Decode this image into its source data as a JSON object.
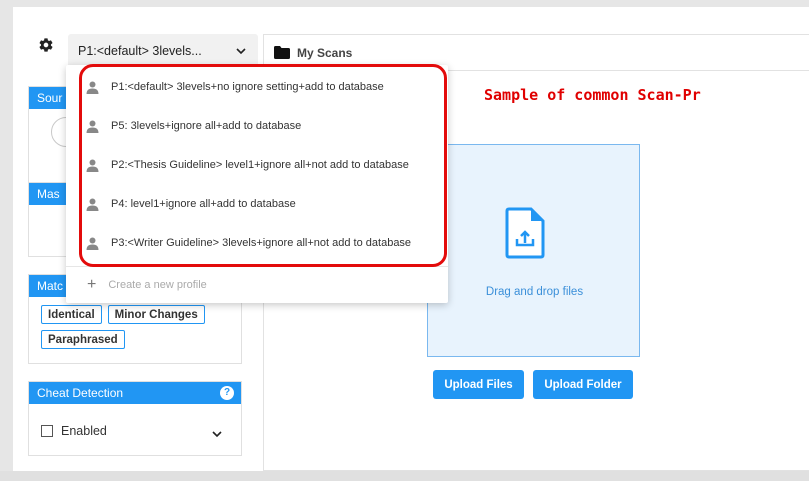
{
  "profile": {
    "selected": "P1:<default> 3levels..."
  },
  "scans": {
    "title": "My Scans"
  },
  "panels": {
    "source_label": "Sour",
    "mask_label": "Mas",
    "match_label": "Matc",
    "match_chips": [
      "Identical",
      "Minor Changes",
      "Paraphrased"
    ],
    "cheat_label": "Cheat Detection",
    "cheat_help": "?",
    "cheat_option": "Enabled"
  },
  "dropzone": {
    "text": "Drag and drop files"
  },
  "buttons": {
    "upload_files": "Upload Files",
    "upload_folder": "Upload Folder"
  },
  "annotation": "Sample of common Scan-Pr",
  "dropdown": {
    "items": [
      {
        "label": "P1:<default> 3levels+no ignore setting+add to database"
      },
      {
        "label": "P5: 3levels+ignore all+add to database"
      },
      {
        "label": "P2:<Thesis Guideline> level1+ignore all+not add to database"
      },
      {
        "label": "P4: level1+ignore all+add to database"
      },
      {
        "label": "P3:<Writer Guideline> 3levels+ignore all+not add to database"
      }
    ],
    "create_label": "Create a new profile"
  },
  "colors": {
    "accent": "#2196f3",
    "annotation_red": "#e30b0b"
  },
  "icons": [
    "gear-icon",
    "chevron-down-icon",
    "folder-icon",
    "person-icon",
    "plus-icon",
    "upload-file-icon",
    "help-icon"
  ]
}
